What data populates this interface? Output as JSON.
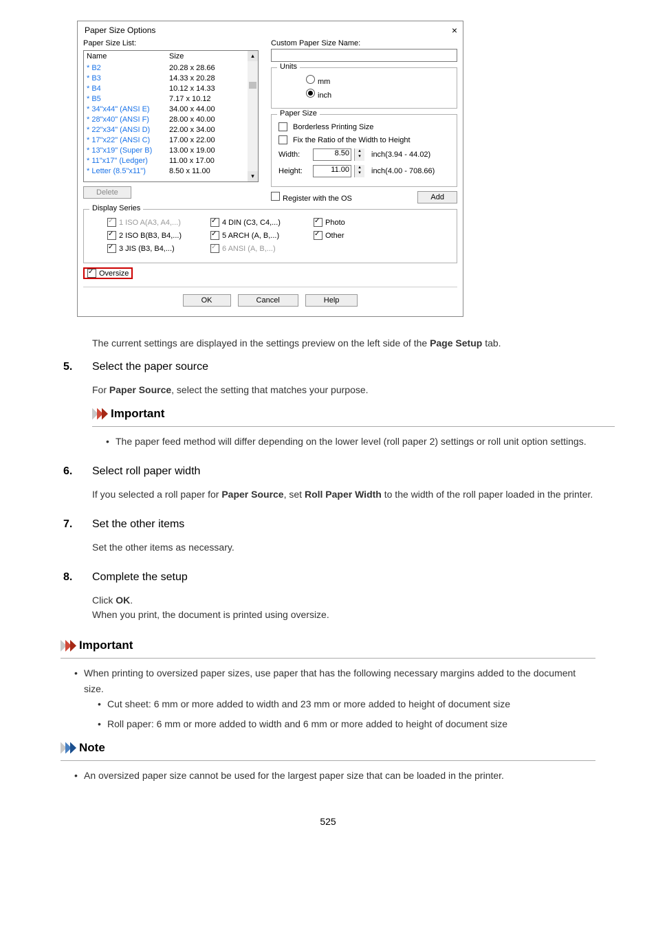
{
  "dialog": {
    "title": "Paper Size Options",
    "paper_size_list_label": "Paper Size List:",
    "custom_name_label": "Custom Paper Size Name:",
    "list_header_name": "Name",
    "list_header_size": "Size",
    "items": [
      {
        "n": "* B2",
        "s": "20.28 x 28.66"
      },
      {
        "n": "* B3",
        "s": "14.33 x 20.28"
      },
      {
        "n": "* B4",
        "s": "10.12 x 14.33"
      },
      {
        "n": "* B5",
        "s": "7.17 x 10.12"
      },
      {
        "n": "* 34\"x44\" (ANSI E)",
        "s": "34.00 x 44.00"
      },
      {
        "n": "* 28\"x40\" (ANSI F)",
        "s": "28.00 x 40.00"
      },
      {
        "n": "* 22\"x34\" (ANSI D)",
        "s": "22.00 x 34.00"
      },
      {
        "n": "* 17\"x22\" (ANSI C)",
        "s": "17.00 x 22.00"
      },
      {
        "n": "* 13\"x19\" (Super B)",
        "s": "13.00 x 19.00"
      },
      {
        "n": "* 11\"x17\" (Ledger)",
        "s": "11.00 x 17.00"
      },
      {
        "n": "* Letter (8.5\"x11\")",
        "s": "8.50 x 11.00"
      }
    ],
    "delete_btn": "Delete",
    "add_btn": "Add",
    "units_legend": "Units",
    "mm_label": "mm",
    "inch_label": "inch",
    "paper_size_legend": "Paper Size",
    "borderless_label": "Borderless Printing Size",
    "fix_ratio_label": "Fix the Ratio of the Width to Height",
    "width_label": "Width:",
    "width_val": "8.50",
    "width_range": "inch(3.94 - 44.02)",
    "height_label": "Height:",
    "height_val": "11.00",
    "height_range": "inch(4.00 - 708.66)",
    "register_os_label": "Register with the OS",
    "display_series_legend": "Display Series",
    "series": [
      {
        "label": "1 ISO A(A3, A4,...)",
        "checked": true,
        "disabled": true
      },
      {
        "label": "4 DIN (C3, C4,...)",
        "checked": true,
        "disabled": false
      },
      {
        "label": "Photo",
        "checked": true,
        "disabled": false
      },
      {
        "label": "2 ISO B(B3, B4,...)",
        "checked": true,
        "disabled": false
      },
      {
        "label": "5 ARCH (A, B,...)",
        "checked": true,
        "disabled": false
      },
      {
        "label": "Other",
        "checked": true,
        "disabled": false
      },
      {
        "label": "3 JIS (B3, B4,...)",
        "checked": true,
        "disabled": false
      },
      {
        "label": "6 ANSI (A, B,...)",
        "checked": true,
        "disabled": true
      }
    ],
    "oversize_label": "Oversize",
    "ok_btn": "OK",
    "cancel_btn": "Cancel",
    "help_btn": "Help"
  },
  "doc": {
    "preview_text_before": "The current settings are displayed in the settings preview on the left side of the ",
    "preview_text_bold": "Page Setup",
    "preview_text_after": " tab.",
    "step5_title": "Select the paper source",
    "step5_body_before": "For ",
    "step5_body_bold": "Paper Source",
    "step5_body_after": ", select the setting that matches your purpose.",
    "important_header": "Important",
    "step5_important": "The paper feed method will differ depending on the lower level (roll paper 2) settings or roll unit option settings.",
    "step6_title": "Select roll paper width",
    "step6_body_1a": "If you selected a roll paper for ",
    "step6_body_1b": "Paper Source",
    "step6_body_1c": ", set ",
    "step6_body_1d": "Roll Paper Width",
    "step6_body_1e": " to the width of the roll paper loaded in the printer.",
    "step7_title": "Set the other items",
    "step7_body": "Set the other items as necessary.",
    "step8_title": "Complete the setup",
    "step8_body_click": "Click ",
    "step8_body_ok": "OK",
    "step8_body_dot": ".",
    "step8_body_2": "When you print, the document is printed using oversize.",
    "outer_important": "When printing to oversized paper sizes, use paper that has the following necessary margins added to the document size.",
    "outer_sub1": "Cut sheet: 6 mm or more added to width and 23 mm or more added to height of document size",
    "outer_sub2": "Roll paper: 6 mm or more added to width and 6 mm or more added to height of document size",
    "note_header": "Note",
    "note_body": "An oversized paper size cannot be used for the largest paper size that can be loaded in the printer.",
    "page_num": "525"
  }
}
